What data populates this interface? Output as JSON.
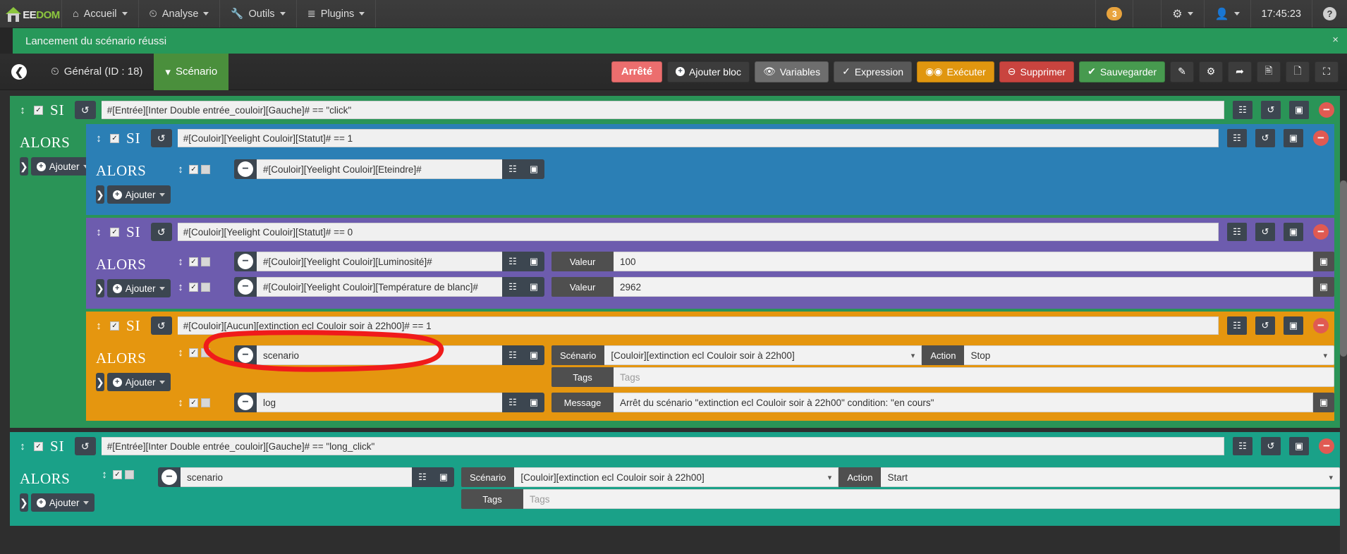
{
  "navbar": {
    "brand": {
      "ee": "EE",
      "dom": "DOM"
    },
    "items": [
      {
        "label": "Accueil",
        "icon": "home-icon"
      },
      {
        "label": "Analyse",
        "icon": "analysis-icon"
      },
      {
        "label": "Outils",
        "icon": "wrench-icon"
      },
      {
        "label": "Plugins",
        "icon": "plugins-icon"
      }
    ],
    "badge_count": "3",
    "gear_icon": "gears-icon",
    "user_icon": "user-icon",
    "clock": "17:45:23",
    "help": "?"
  },
  "alert": {
    "message": "Lancement du scénario réussi",
    "close": "×"
  },
  "toolbar": {
    "back": "❮",
    "breadcrumb": "Général (ID : 18)",
    "tab_scenario": "Scénario",
    "status": "Arrêté",
    "add_block": "Ajouter bloc",
    "variables": "Variables",
    "expression": "Expression",
    "execute": "Exécuter",
    "delete": "Supprimer",
    "save": "Sauvegarder",
    "icons": [
      "edit-icon",
      "share-icon",
      "forward-icon",
      "document-icon",
      "copy-icon",
      "expand-icon"
    ]
  },
  "common": {
    "si": "SI",
    "alors": "ALORS",
    "ajouter": "Ajouter",
    "tags_label": "Tags",
    "tags_placeholder": "Tags",
    "scenario_label": "Scénario",
    "action_label": "Action",
    "valeur_label": "Valeur",
    "message_label": "Message"
  },
  "blocks": [
    {
      "id": "green-outer",
      "color": "#2a9457",
      "condition": "#[Entrée][Inter Double entrée_couloir][Gauche]# == \"click\"",
      "children": [
        {
          "id": "blue",
          "color": "#2b7fb5",
          "condition": "#[Couloir][Yeelight Couloir][Statut]# == 1",
          "actions": [
            {
              "cmd": "#[Couloir][Yeelight Couloir][Eteindre]#",
              "options": []
            }
          ]
        },
        {
          "id": "purple",
          "color": "#6d5cae",
          "condition": "#[Couloir][Yeelight Couloir][Statut]# == 0",
          "actions": [
            {
              "cmd": "#[Couloir][Yeelight Couloir][Luminosité]#",
              "options": [
                {
                  "label": "Valeur",
                  "value": "100"
                }
              ]
            },
            {
              "cmd": "#[Couloir][Yeelight Couloir][Température de blanc]#",
              "options": [
                {
                  "label": "Valeur",
                  "value": "2962"
                }
              ]
            }
          ]
        },
        {
          "id": "orange",
          "color": "#e5960f",
          "condition": "#[Couloir][Aucun][extinction ecl Couloir soir à 22h00]# == 1",
          "highlighted": true,
          "actions": [
            {
              "cmd": "scenario",
              "scenario_value": "[Couloir][extinction ecl Couloir soir à 22h00]",
              "action_value": "Stop",
              "tags_value": ""
            },
            {
              "cmd": "log",
              "message_value": "Arrêt du scénario \"extinction ecl Couloir soir à 22h00\" condition: \"en cours\""
            }
          ]
        }
      ]
    },
    {
      "id": "teal-outer",
      "color": "#1aa188",
      "condition": "#[Entrée][Inter Double entrée_couloir][Gauche]# == \"long_click\"",
      "actions": [
        {
          "cmd": "scenario",
          "scenario_value": "[Couloir][extinction ecl Couloir soir à 22h00]",
          "action_value": "Start",
          "tags_value": ""
        }
      ]
    }
  ],
  "annotation": {
    "shape": "red-ellipse",
    "color": "#f01b1b"
  }
}
